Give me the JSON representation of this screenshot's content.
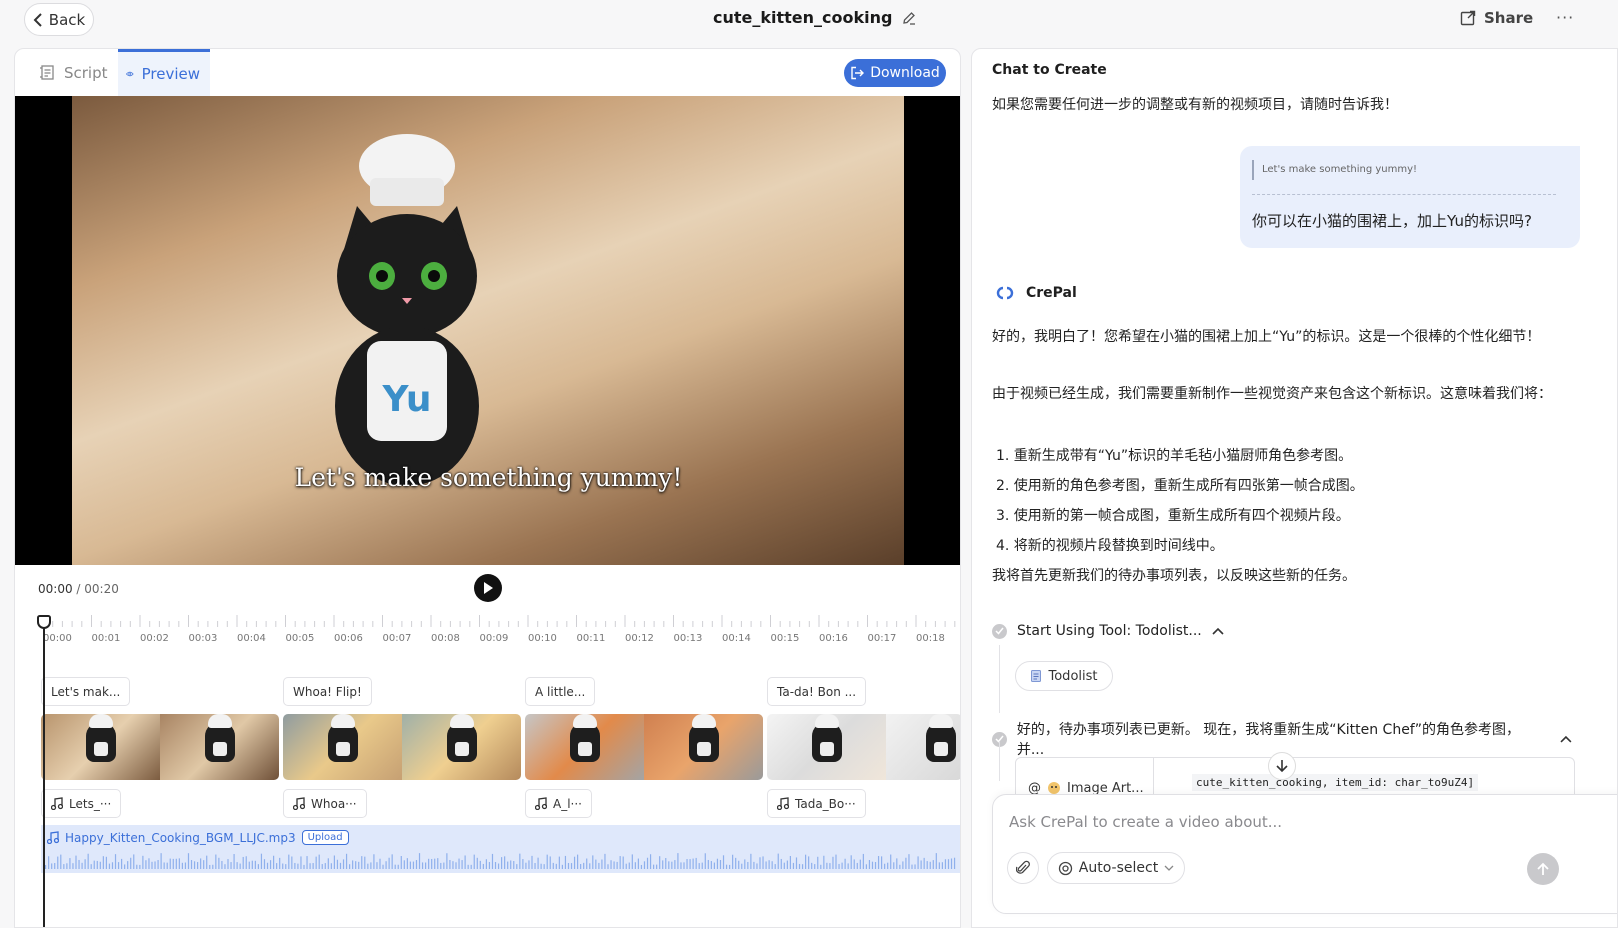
{
  "header": {
    "back_label": "Back",
    "title": "cute_kitten_cooking",
    "share_label": "Share",
    "more_label": "···"
  },
  "left": {
    "tabs": [
      {
        "label": "Script"
      },
      {
        "label": "Preview"
      }
    ],
    "download_label": "Download",
    "video_caption": "Let's make something yummy!",
    "current_time": "00:00",
    "total_time": "/ 00:20",
    "ruler_ticks": [
      "00:00",
      "00:01",
      "00:02",
      "00:03",
      "00:04",
      "00:05",
      "00:06",
      "00:07",
      "00:08",
      "00:09",
      "00:10",
      "00:11",
      "00:12",
      "00:13",
      "00:14",
      "00:15",
      "00:16",
      "00:17",
      "00:18"
    ],
    "clips": [
      {
        "label": "Let's mak...",
        "audio": "Lets_···"
      },
      {
        "label": "Whoa! Flip!",
        "audio": "Whoa···"
      },
      {
        "label": "A little...",
        "audio": "A_l···"
      },
      {
        "label": "Ta-da! Bon ...",
        "audio": "Tada_Bo···"
      }
    ],
    "bgm_name": "Happy_Kitten_Cooking_BGM_LLJC.mp3",
    "upload_label": "Upload"
  },
  "chat": {
    "title": "Chat to Create",
    "msg_intro": "如果您需要任何进一步的调整或有新的视频项目，请随时告诉我！",
    "user_quote": "Let's make something yummy!",
    "user_text": "你可以在小猫的围裙上，加上Yu的标识吗?",
    "bot_name": "CrePal",
    "bot_p1": "好的，我明白了！您希望在小猫的围裙上加上“Yu”的标识。这是一个很棒的个性化细节！",
    "bot_p2": "由于视频已经生成，我们需要重新制作一些视觉资产来包含这个新标识。这意味着我们将：",
    "steps": [
      "1. 重新生成带有“Yu”标识的羊毛毡小猫厨师角色参考图。",
      "2. 使用新的角色参考图，重新生成所有四张第一帧合成图。",
      "3. 使用新的第一帧合成图，重新生成所有四个视频片段。",
      "4. 将新的视频片段替换到时间线中。"
    ],
    "bot_p3": "我将首先更新我们的待办事项列表，以反映这些新的任务。",
    "tool1": "Start Using Tool: Todolist...",
    "todolist_chip": "Todolist",
    "tool2": "好的，待办事项列表已更新。 现在，我将重新生成“Kitten Chef”的角色参考图，并...",
    "image_art_label": "Image Art...",
    "code_snippet": "cute_kitten_cooking, item_id: char_to9uZ4]",
    "input_placeholder": "Ask CrePal to create a video about...",
    "auto_select_label": "Auto-select"
  },
  "colors": {
    "accent": "#3b6fd8",
    "bgm_bg": "#dfe8fb",
    "bubble_bg": "#e9effc"
  }
}
